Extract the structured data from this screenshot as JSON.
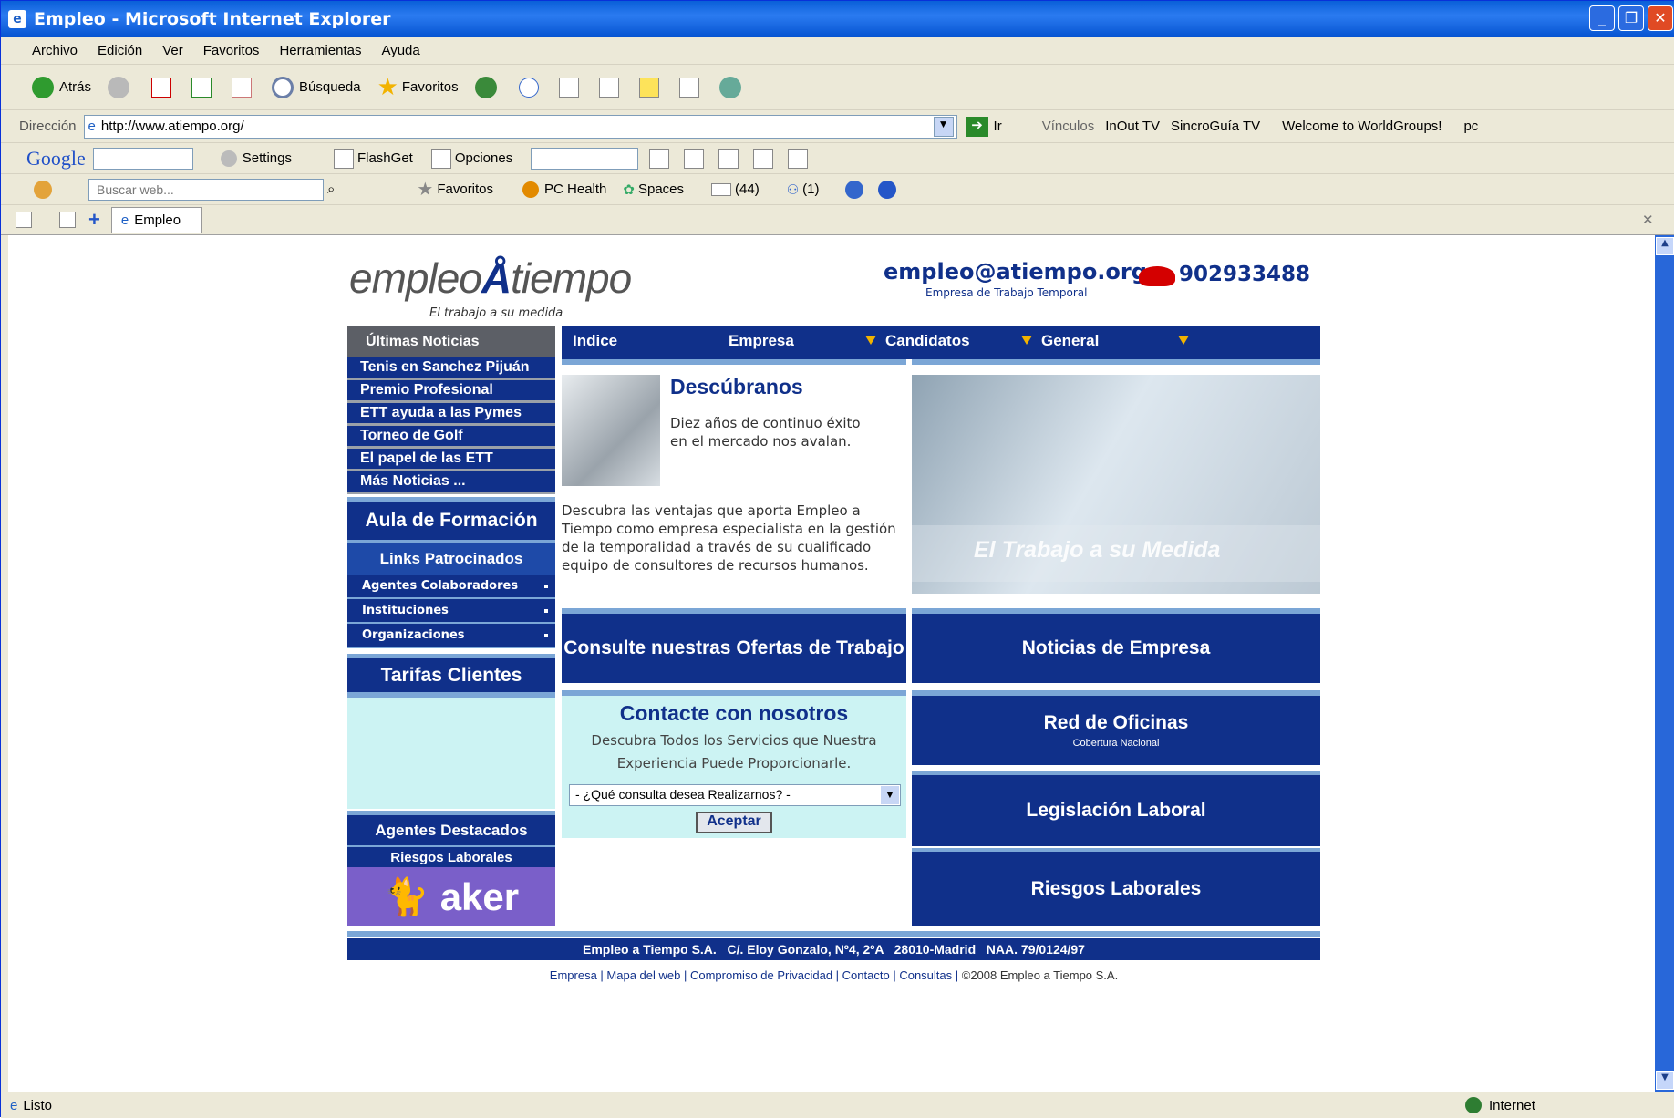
{
  "window": {
    "title": "Empleo - Microsoft Internet Explorer"
  },
  "menu": [
    "Archivo",
    "Edición",
    "Ver",
    "Favoritos",
    "Herramientas",
    "Ayuda"
  ],
  "toolbar": {
    "back": "Atrás",
    "search": "Búsqueda",
    "favorites": "Favoritos"
  },
  "address": {
    "label": "Dirección",
    "url": "http://www.atiempo.org/",
    "go": "Ir",
    "links_label": "Vínculos",
    "links": [
      "InOut TV",
      "SincroGuía TV",
      "Welcome to WorldGroups!",
      "pc"
    ]
  },
  "google": {
    "brand": "Google",
    "settings": "Settings",
    "flashget": "FlashGet",
    "options": "Opciones"
  },
  "live": {
    "search_placeholder": "Buscar web...",
    "favorites": "Favoritos",
    "pchealth": "PC Health",
    "spaces": "Spaces",
    "mail_count": "(44)",
    "contacts_count": "(1)"
  },
  "tab": {
    "label": "Empleo"
  },
  "status": {
    "text": "Listo",
    "zone": "Internet"
  },
  "page": {
    "logo_left": "empleo",
    "logo_right": "tiempo",
    "tagline": "El trabajo a su medida",
    "email": "empleo@atiempo.org",
    "company_type": "Empresa de Trabajo Temporal",
    "phone": "902933488",
    "news_header": "Últimas Noticias",
    "news": [
      "Tenis en Sanchez Pijuán",
      "Premio Profesional",
      "ETT ayuda a las Pymes",
      "Torneo de Golf",
      "El papel de las ETT",
      "Más Noticias ..."
    ],
    "aula": "Aula de Formación",
    "links_header": "Links Patrocinados",
    "links": [
      "Agentes Colaboradores",
      "Instituciones",
      "Organizaciones"
    ],
    "tarifas": "Tarifas Clientes",
    "agentes": "Agentes Destacados",
    "riesgos_small": "Riesgos Laborales",
    "aker": "aker",
    "nav": [
      "Indice",
      "Empresa",
      "Candidatos",
      "General"
    ],
    "descubranos_title": "Descúbranos",
    "descubranos_sub": "Diez años de continuo éxito en el mercado nos avalan.",
    "descubranos_body": "Descubra las ventajas que aporta Empleo a Tiempo como empresa especialista en la gestión de la temporalidad a través de su cualificado equipo de consultores de recursos humanos.",
    "banner_text": "El Trabajo a su Medida",
    "ofertas": "Consulte nuestras Ofertas de Trabajo",
    "contact_title": "Contacte con nosotros",
    "contact_text": "Descubra Todos los Servicios que Nuestra Experiencia Puede Proporcionarle.",
    "contact_select": "- ¿Qué consulta desea Realizarnos? -",
    "contact_button": "Aceptar",
    "right_boxes": [
      {
        "title": "Noticias de Empresa",
        "sub": ""
      },
      {
        "title": "Red de Oficinas",
        "sub": "Cobertura Nacional"
      },
      {
        "title": "Legislación Laboral",
        "sub": ""
      },
      {
        "title": "Riesgos Laborales",
        "sub": ""
      }
    ],
    "footer_address": "Empleo a Tiempo S.A.   C/. Eloy Gonzalo, Nº4, 2ºA   28010-Madrid   NAA. 79/0124/97",
    "footer_links": [
      "Empresa",
      "Mapa del web",
      "Compromiso de Privacidad",
      "Contacto",
      "Consultas"
    ],
    "copyright": "©2008 Empleo a Tiempo S.A."
  }
}
